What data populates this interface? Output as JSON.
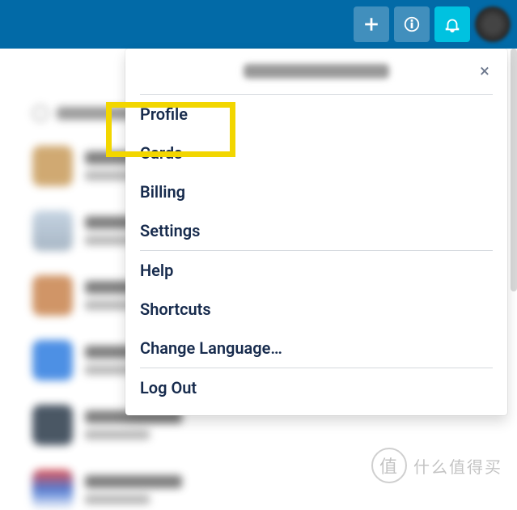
{
  "topbar": {
    "add_label": "Add",
    "info_label": "Info",
    "notifications_label": "Notifications"
  },
  "dropdown": {
    "close_label": "×",
    "sections": [
      [
        "Profile",
        "Cards",
        "Billing",
        "Settings"
      ],
      [
        "Help",
        "Shortcuts",
        "Change Language…"
      ],
      [
        "Log Out"
      ]
    ]
  },
  "highlight": {
    "target_item": "Profile"
  },
  "watermark": {
    "text": "什么值得买",
    "icon_char": "值"
  }
}
